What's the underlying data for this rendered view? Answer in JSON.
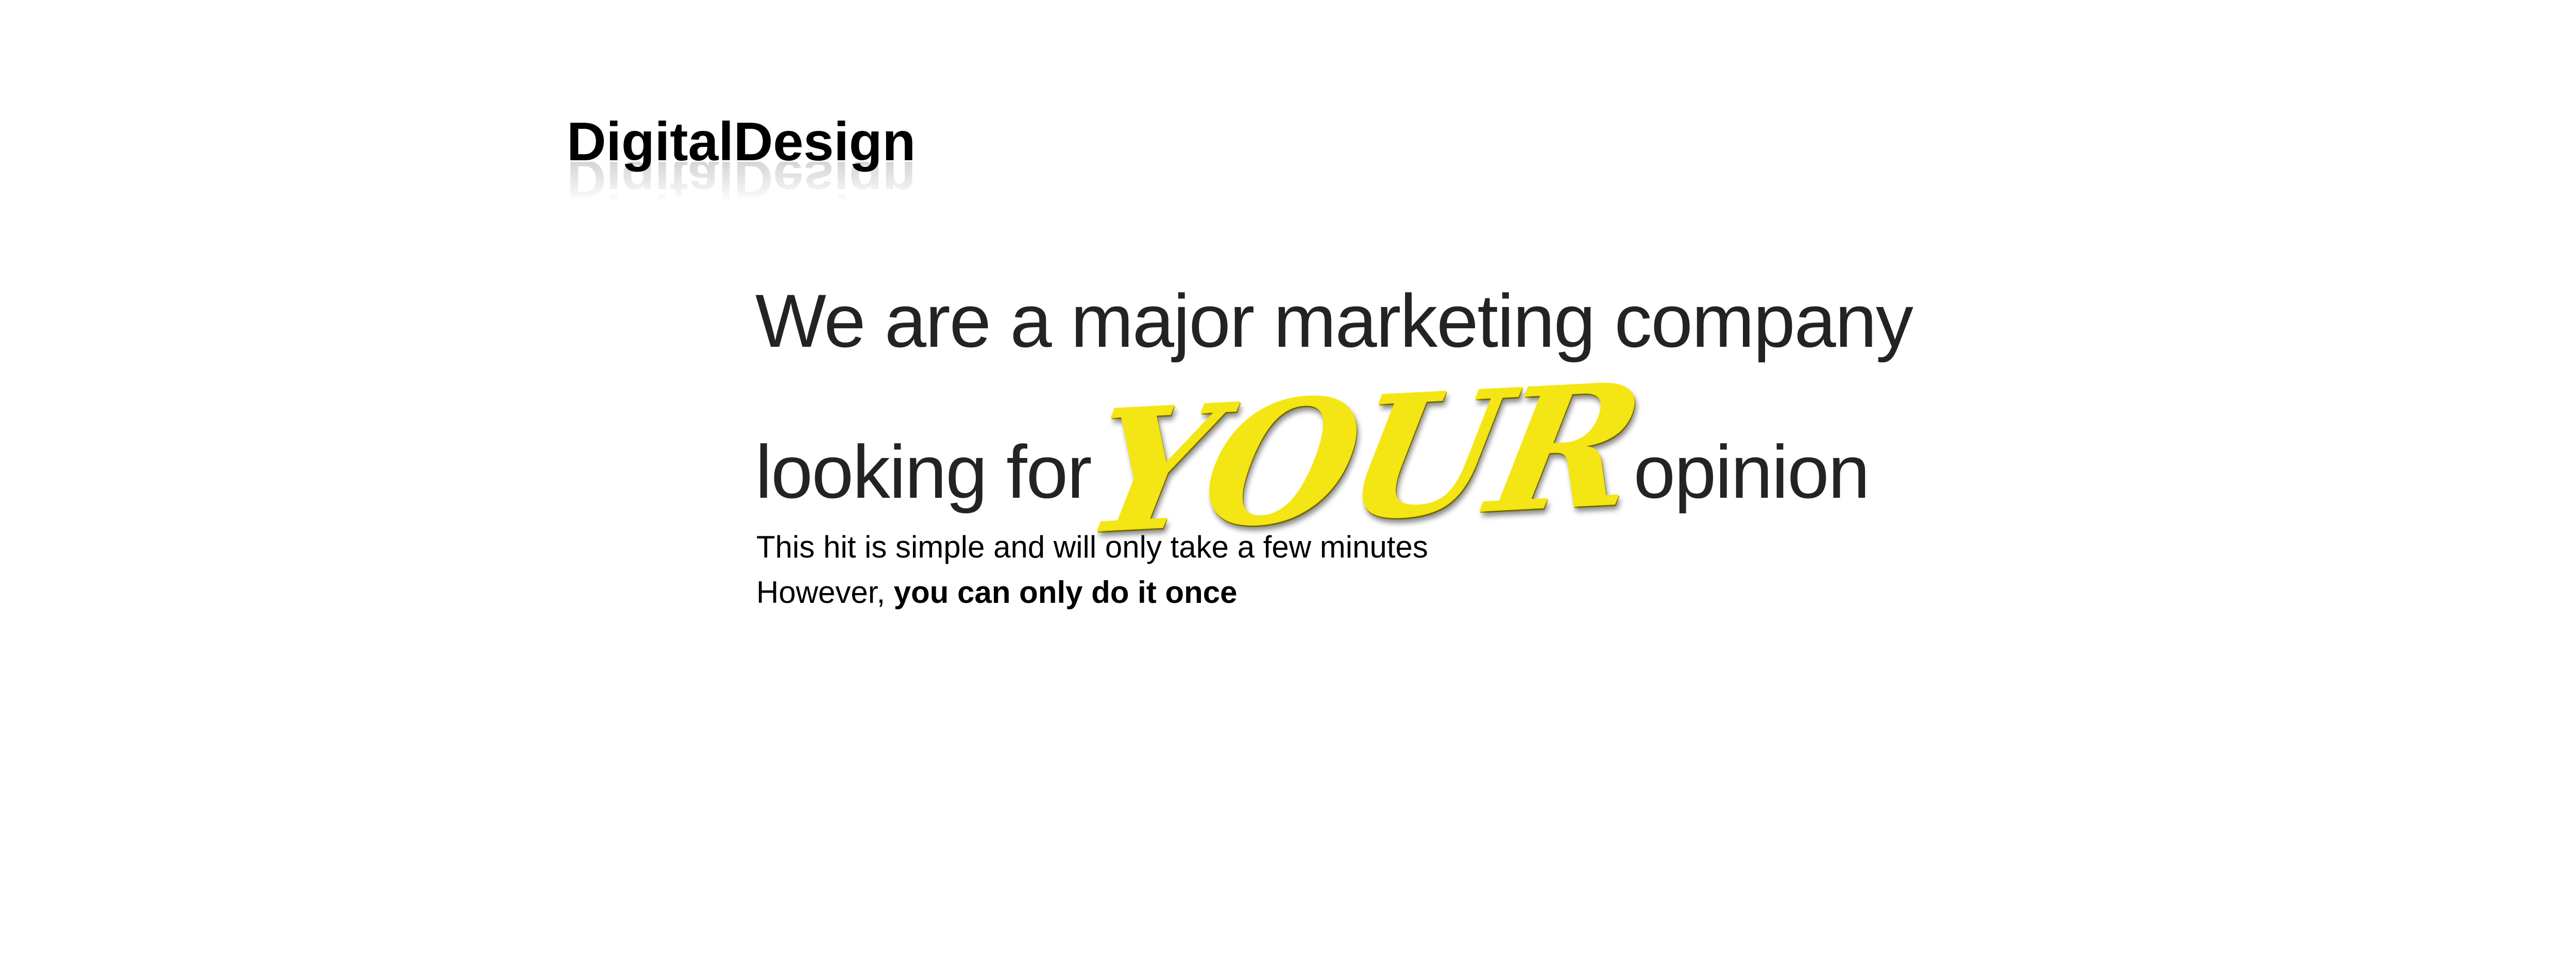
{
  "logo": {
    "text": "DigitalDesign"
  },
  "headline": {
    "line1": "We are a major marketing company",
    "line2_before": "looking for",
    "line2_emphasis": "YOUR",
    "line2_after": "opinion"
  },
  "body": {
    "line1": "This hit is simple and will only take a few minutes",
    "line2_prefix": "However, ",
    "line2_bold": "you can only do it once"
  },
  "colors": {
    "accent_yellow": "#f4e514",
    "text": "#000000",
    "background": "#ffffff"
  }
}
